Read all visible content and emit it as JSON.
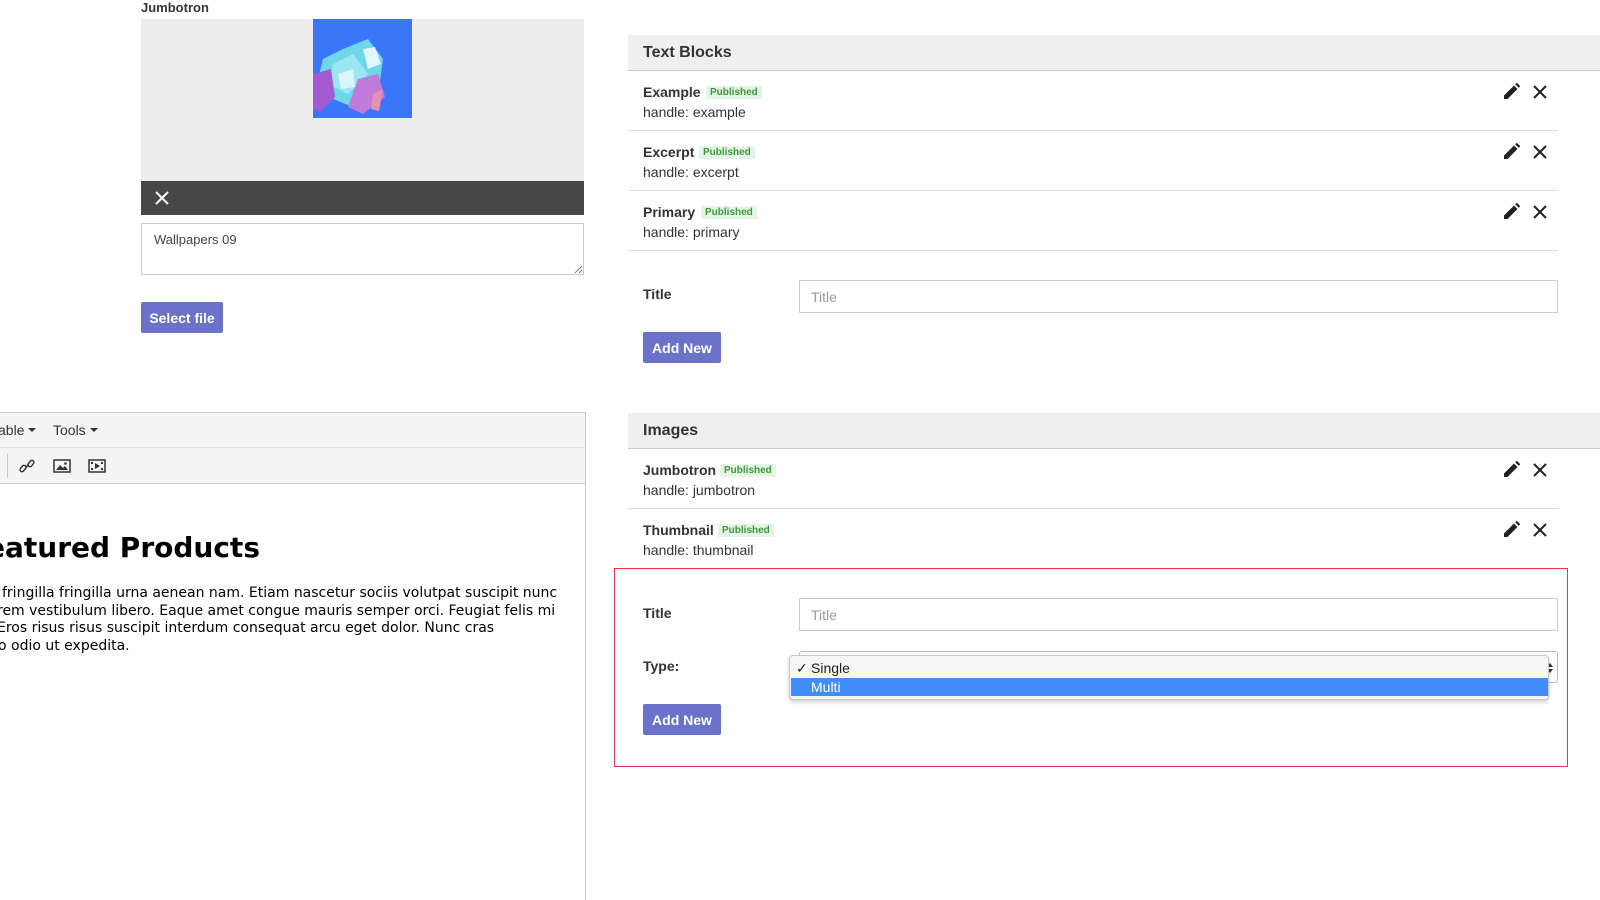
{
  "jumbotron_uploader": {
    "label": "Jumbotron",
    "caption": "Wallpapers 09",
    "select_file_label": "Select file"
  },
  "editor": {
    "menu": {
      "table": "able",
      "tools": "Tools"
    },
    "heading": "eatured Products",
    "body_lines": [
      "fringilla fringilla urna aenean nam. Etiam nascetur sociis volutpat suscipit nunc",
      "rem vestibulum libero. Eaque amet congue mauris semper orci. Feugiat felis mi",
      "Eros risus risus suscipit interdum consequat arcu eget dolor. Nunc cras",
      "o odio ut expedita."
    ]
  },
  "text_blocks": {
    "title": "Text Blocks",
    "items": [
      {
        "name": "Example",
        "status": "Published",
        "handle": "handle: example"
      },
      {
        "name": "Excerpt",
        "status": "Published",
        "handle": "handle: excerpt"
      },
      {
        "name": "Primary",
        "status": "Published",
        "handle": "handle: primary"
      }
    ],
    "form": {
      "title_label": "Title",
      "title_placeholder": "Title",
      "add_label": "Add New"
    }
  },
  "images": {
    "title": "Images",
    "items": [
      {
        "name": "Jumbotron",
        "status": "Published",
        "handle": "handle: jumbotron"
      },
      {
        "name": "Thumbnail",
        "status": "Published",
        "handle": "handle: thumbnail"
      }
    ],
    "form": {
      "title_label": "Title",
      "title_placeholder": "Title",
      "type_label": "Type:",
      "type_options": [
        "Single",
        "Multi"
      ],
      "type_selected": "Single",
      "type_highlighted": "Multi",
      "add_label": "Add New"
    }
  },
  "colors": {
    "primary_button": "#6a72c9",
    "published_badge": "#3c9a3c",
    "highlight_border": "#e53b3b",
    "dropdown_highlight": "#3f8df7"
  }
}
